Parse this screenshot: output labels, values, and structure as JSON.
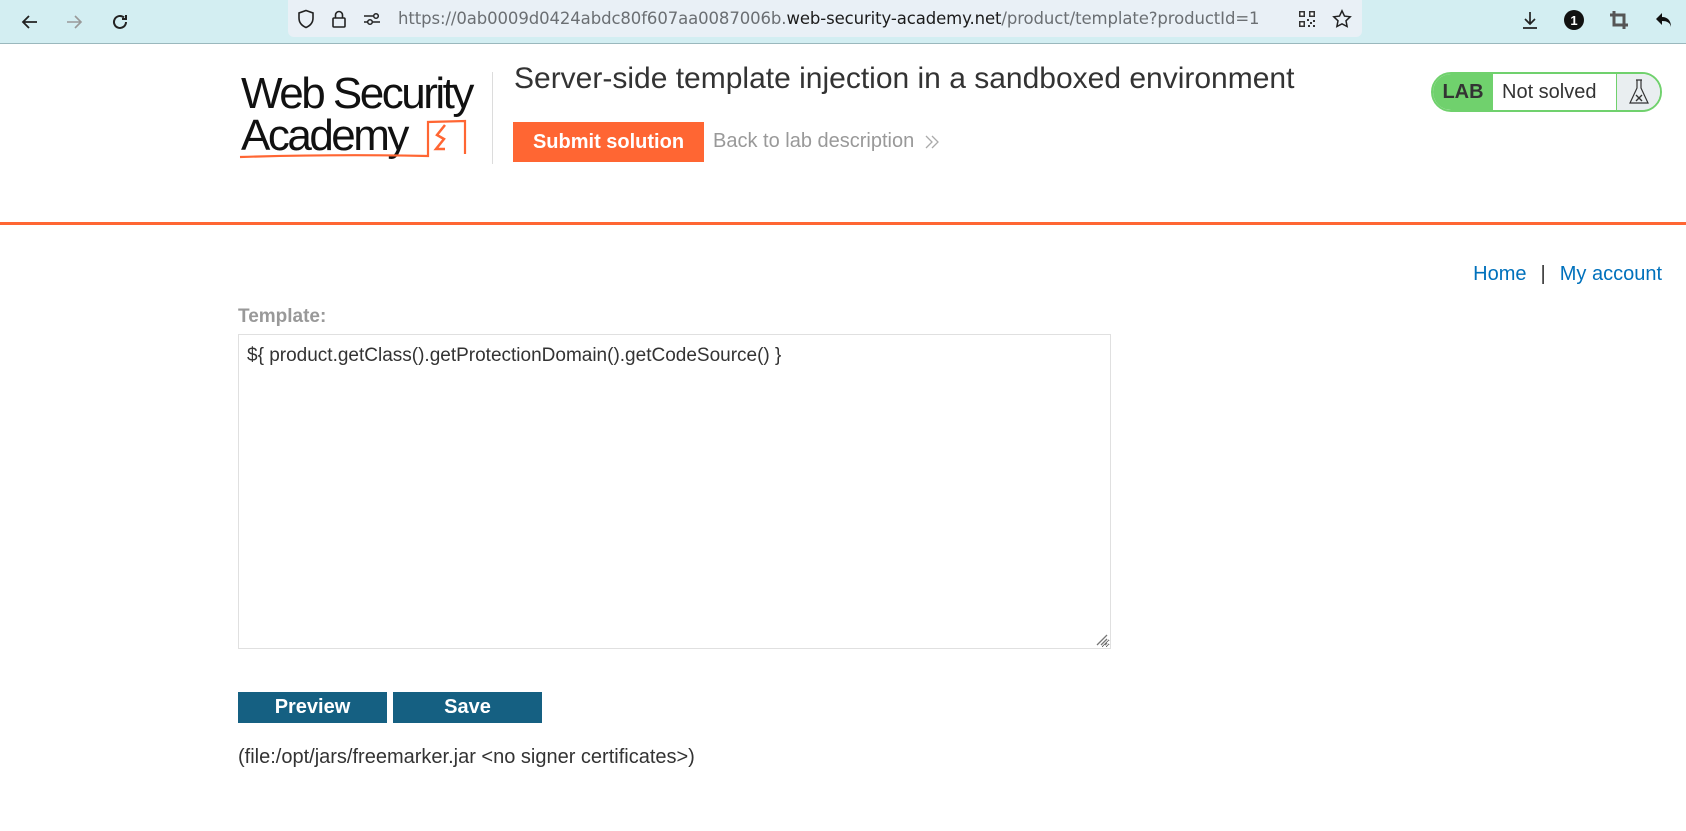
{
  "browser": {
    "url_prefix": "https://0ab0009d0424abdc80f607aa0087006b.",
    "url_domain": "web-security-academy.net",
    "url_suffix": "/product/template?productId=1",
    "notification_count": "1",
    "icons": [
      "back-icon",
      "forward-icon",
      "reload-icon",
      "shield-icon",
      "lock-icon",
      "permissions-icon",
      "qr-code-icon",
      "bookmark-star-icon",
      "download-icon",
      "notification-badge-icon",
      "crop-icon",
      "undo-icon"
    ]
  },
  "header": {
    "logo_line1": "Web Security",
    "logo_line2": "Academy",
    "lab_title": "Server-side template injection in a sandboxed environment",
    "submit_label": "Submit solution",
    "back_label": "Back to lab description",
    "badge_lab": "LAB",
    "badge_status": "Not solved",
    "accent_color": "#ff6633",
    "badge_color": "#70d16d"
  },
  "nav": {
    "home": "Home",
    "separator": "|",
    "account": "My account"
  },
  "form": {
    "template_label": "Template:",
    "template_value": "${ product.getClass().getProtectionDomain().getCodeSource() }",
    "preview_label": "Preview",
    "save_label": "Save",
    "button_color": "#156082"
  },
  "output": {
    "text": "(file:/opt/jars/freemarker.jar <no signer certificates>)"
  }
}
